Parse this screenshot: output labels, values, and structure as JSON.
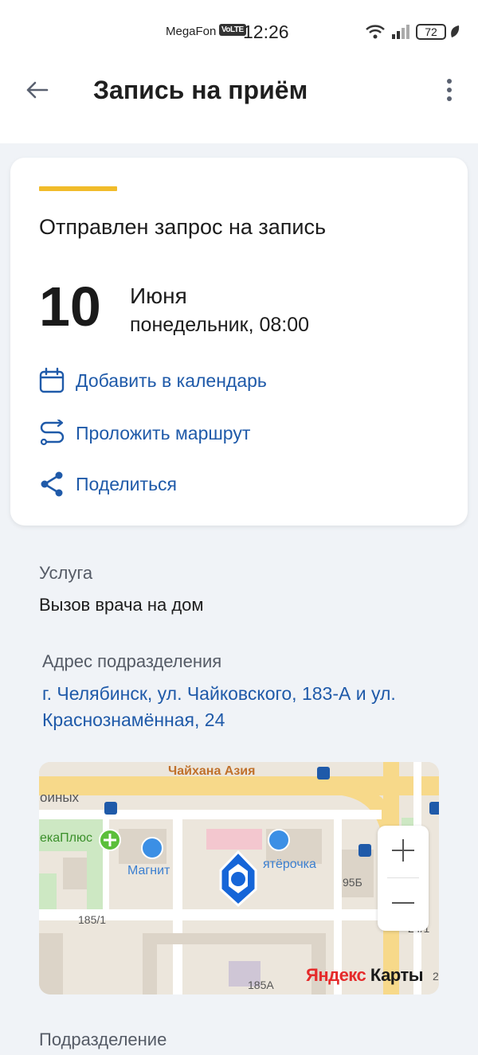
{
  "status_bar": {
    "carrier": "MegaFon",
    "volte": "VoLTE",
    "time": "12:26",
    "battery": "72"
  },
  "appbar": {
    "title": "Запись на приём",
    "back_icon": "arrow-left-icon",
    "menu_icon": "more-vertical-icon"
  },
  "appointment": {
    "status": "Отправлен запрос на запись",
    "status_color": "#f1bc2a",
    "day": "10",
    "month": "Июня",
    "weekday_time": "понедельник, 08:00"
  },
  "actions": [
    {
      "label": "Добавить в календарь",
      "icon": "calendar-icon"
    },
    {
      "label": "Проложить маршрут",
      "icon": "route-icon"
    },
    {
      "label": "Поделиться",
      "icon": "share-icon"
    }
  ],
  "service": {
    "label": "Услуга",
    "value": "Вызов врача на дом"
  },
  "address": {
    "label": "Адрес подразделения",
    "value": "г. Челябинск, ул. Чайковского, 183-А и ул. Краснознамённая, 24"
  },
  "map": {
    "labels": {
      "chaikhana": "Чайхана Азия",
      "edge_top_left": "оиных",
      "apteka": "екаПлюс",
      "magnit": "Магнит",
      "pyaterochka": "ятёрочка",
      "b95": "95Б",
      "b185_1": "185/1",
      "b185a": "185А",
      "b24_1": "24/1",
      "edge_right": "2"
    },
    "logo_ya": "Яндекс",
    "logo_rest": " Карты",
    "zoom_in_icon": "plus-icon",
    "zoom_out_icon": "minus-icon",
    "pin_icon": "location-pin-icon"
  },
  "department": {
    "label": "Подразделение"
  },
  "colors": {
    "accent": "#1f5aa9",
    "pin": "#1565d8"
  }
}
